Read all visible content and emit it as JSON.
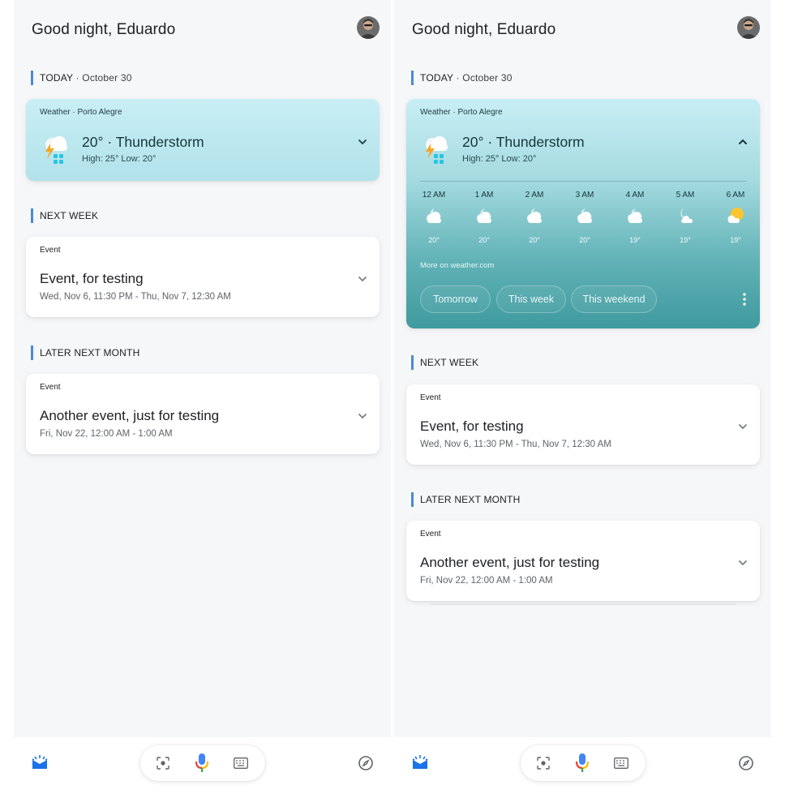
{
  "greeting": "Good night, Eduardo",
  "today_section": {
    "title": "TODAY",
    "subtitle": " · October 30"
  },
  "weather": {
    "label": "Weather · Porto Alegre",
    "temp_condition": "20° · Thunderstorm",
    "high_low": "High: 25° Low: 20°",
    "hourly": [
      {
        "time": "12 AM",
        "temp": "20°",
        "icon": "partly-cloudy-night-icon"
      },
      {
        "time": "1 AM",
        "temp": "20°",
        "icon": "partly-cloudy-night-icon"
      },
      {
        "time": "2 AM",
        "temp": "20°",
        "icon": "partly-cloudy-night-icon"
      },
      {
        "time": "3 AM",
        "temp": "20°",
        "icon": "partly-cloudy-night-icon"
      },
      {
        "time": "4 AM",
        "temp": "19°",
        "icon": "partly-cloudy-night-icon"
      },
      {
        "time": "5 AM",
        "temp": "19°",
        "icon": "moon-cloud-icon"
      },
      {
        "time": "6 AM",
        "temp": "19°",
        "icon": "partly-cloudy-day-icon"
      }
    ],
    "more_link": "More on weather.com",
    "chips": [
      "Tomorrow",
      "This week",
      "This weekend"
    ]
  },
  "next_week_section": {
    "title": "NEXT WEEK"
  },
  "event1": {
    "label": "Event",
    "title": "Event, for testing",
    "time": "Wed, Nov 6, 11:30 PM - Thu, Nov 7, 12:30 AM"
  },
  "later_section": {
    "title": "LATER NEXT MONTH"
  },
  "event2": {
    "label": "Event",
    "title": "Another event, just for testing",
    "time": "Fri, Nov 22, 12:00 AM - 1:00 AM"
  },
  "colors": {
    "accent_bar": "#4a8ad6",
    "weather_card_top": "#c8eef5",
    "weather_card_bottom": "#3f9a9e",
    "mic_blue": "#4285f4",
    "mic_red": "#ea4335",
    "mic_yellow": "#fbbc05",
    "mic_green": "#34a853"
  }
}
